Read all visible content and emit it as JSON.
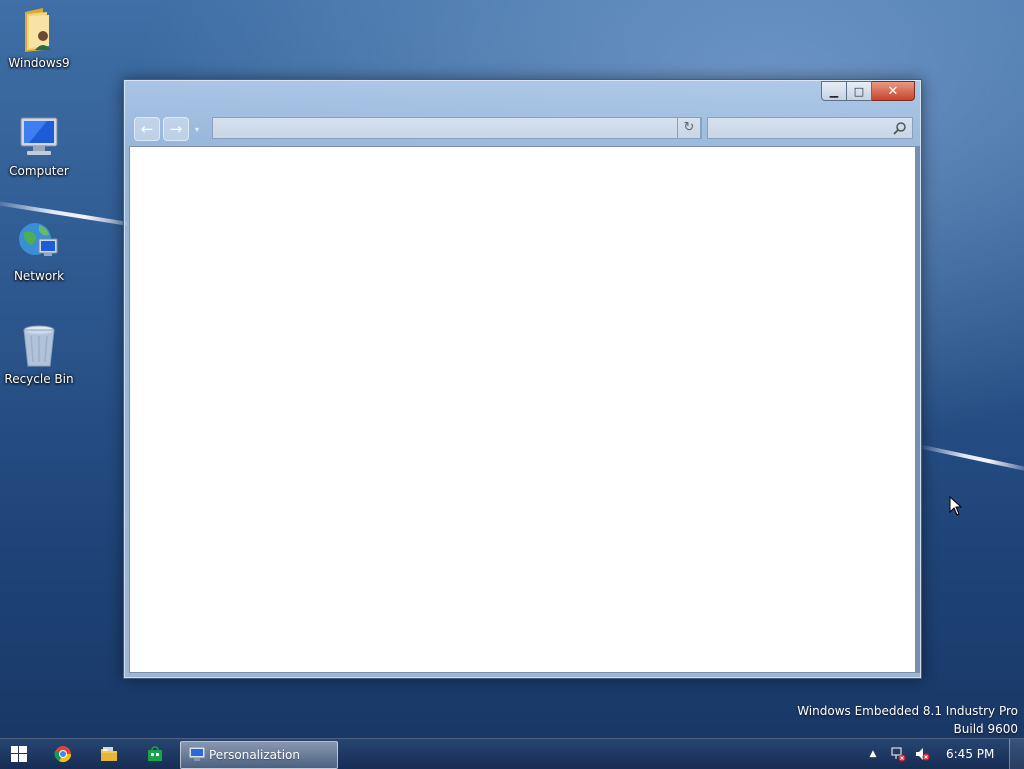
{
  "desktop": {
    "icons": [
      {
        "label": "Windows9",
        "icon": "folder-user-icon"
      },
      {
        "label": "Computer",
        "icon": "computer-icon"
      },
      {
        "label": "Network",
        "icon": "network-icon"
      },
      {
        "label": "Recycle Bin",
        "icon": "recycle-bin-icon"
      }
    ],
    "watermark": {
      "line1": "Windows Embedded 8.1 Industry Pro",
      "line2": "Build 9600"
    }
  },
  "window": {
    "caption_buttons": {
      "minimize": "minimize",
      "maximize": "maximize",
      "close": "close"
    },
    "address_bar": {
      "value": "",
      "placeholder": ""
    },
    "search_box": {
      "value": "",
      "placeholder": ""
    }
  },
  "taskbar": {
    "pinned": [
      "start-button",
      "chrome-icon",
      "file-explorer-icon",
      "store-icon"
    ],
    "active_app": {
      "label": "Personalization"
    },
    "tray": {
      "icons": [
        "show-hidden-icons-arrow",
        "network-disconnected-icon",
        "volume-muted-icon"
      ],
      "time": "6:45 PM"
    }
  },
  "colors": {
    "desktop_top": "#3f6fa6",
    "desktop_bottom": "#183664",
    "close_button": "#c8452c",
    "taskbar": "#1c3a6c"
  }
}
